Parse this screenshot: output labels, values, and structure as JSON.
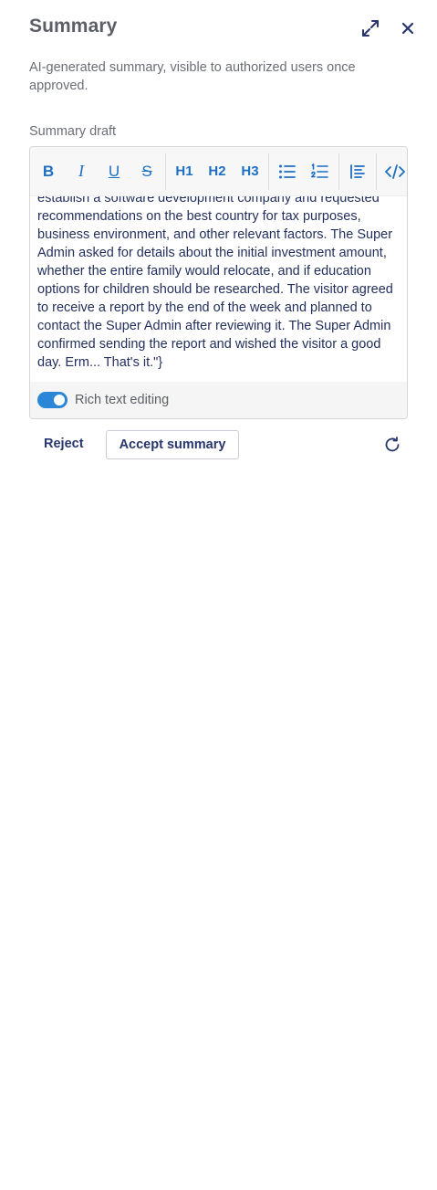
{
  "header": {
    "title": "Summary",
    "expand_icon": "expand-icon",
    "close_icon": "close-icon"
  },
  "description": "AI-generated summary, visible to authorized users once approved.",
  "field_label": "Summary draft",
  "toolbar": {
    "bold": "B",
    "italic": "I",
    "underline": "U",
    "strike": "S",
    "h1": "H1",
    "h2": "H2",
    "h3": "H3",
    "bullet_list_icon": "bullet-list-icon",
    "ordered_list_icon": "ordered-list-icon",
    "blockquote_icon": "blockquote-icon",
    "code_icon": "code-icon"
  },
  "content": "establish a software development company and requested recommendations on the best country for tax purposes, business environment, and other relevant factors. The Super Admin asked for details about the initial investment amount, whether the entire family would relocate, and if education options for children should be researched. The visitor agreed to receive a report by the end of the week and planned to contact the Super Admin after reviewing it. The Super Admin confirmed sending the report and wished the visitor a good day. Erm... That's it.\"}",
  "rich_text": {
    "label": "Rich text editing",
    "enabled": true
  },
  "actions": {
    "reject": "Reject",
    "accept": "Accept summary",
    "refresh_icon": "refresh-icon"
  },
  "colors": {
    "accent": "#1d6fc4",
    "toggle_on": "#2b86d8",
    "text_dark": "#27366d"
  }
}
